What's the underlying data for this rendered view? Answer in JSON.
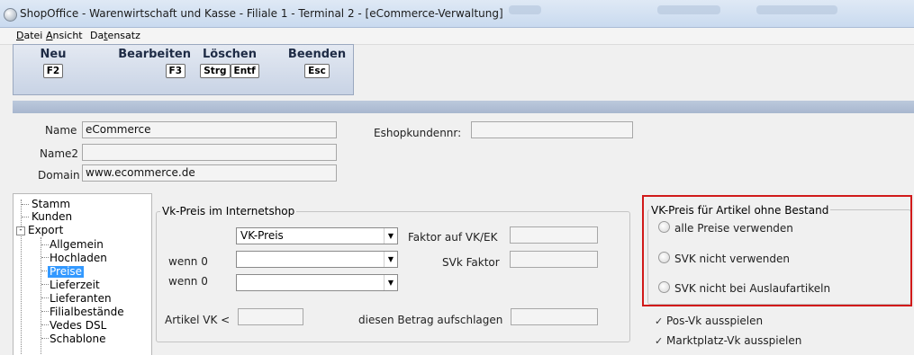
{
  "window": {
    "title": "ShopOffice - Warenwirtschaft und Kasse - Filiale 1 - Terminal 2 - [eCommerce-Verwaltung]"
  },
  "menu": {
    "datei": {
      "underline": "D",
      "rest": "atei"
    },
    "ansicht": {
      "underline": "A",
      "rest": "nsicht"
    },
    "datensatz": {
      "prefix": "Da",
      "underline": "t",
      "rest": "ensatz"
    }
  },
  "toolbar": {
    "neu": {
      "label": "Neu",
      "keys": [
        "F2"
      ]
    },
    "bearbeiten": {
      "label": "Bearbeiten",
      "keys": [
        "F3"
      ]
    },
    "loeschen": {
      "label": "Löschen",
      "keys": [
        "Strg",
        "Entf"
      ]
    },
    "beenden": {
      "label": "Beenden",
      "keys": [
        "Esc"
      ]
    }
  },
  "header": {
    "name_label": "Name",
    "name_value": "eCommerce",
    "name2_label": "Name2",
    "name2_value": "",
    "domain_label": "Domain",
    "domain_value": "www.ecommerce.de",
    "eshop_label": "Eshopkundennr:",
    "eshop_value": ""
  },
  "tree": {
    "stamm": "Stamm",
    "kunden": "Kunden",
    "export": "Export",
    "allgemein": "Allgemein",
    "hochladen": "Hochladen",
    "preise": "Preise",
    "lieferzeit": "Lieferzeit",
    "lieferanten": "Lieferanten",
    "filialbestaende": "Filialbestände",
    "vedes": "Vedes DSL",
    "schablone": "Schablone",
    "expander_minus": "-"
  },
  "vk_group": {
    "title": "Vk-Preis im Internetshop",
    "select1_value": "VK-Preis",
    "faktor_label": "Faktor auf VK/EK",
    "faktor_value": "",
    "wenn0_label_1": "wenn 0",
    "select2_value": "",
    "svk_label": "SVk Faktor",
    "svk_value": "",
    "wenn0_label_2": "wenn 0",
    "select3_value": "",
    "artikel_label": "Artikel VK <",
    "artikel_value": "",
    "aufschlag_label": "diesen Betrag aufschlagen",
    "aufschlag_value": ""
  },
  "bestand_group": {
    "title": "VK-Preis für Artikel ohne Bestand",
    "options": [
      "alle Preise verwenden",
      "SVK nicht verwenden",
      "SVK nicht bei Auslaufartikeln"
    ]
  },
  "checks": {
    "pos": {
      "mark": "✓",
      "label": "Pos-Vk ausspielen"
    },
    "markt": {
      "mark": "✓",
      "label": "Marktplatz-Vk ausspielen"
    }
  },
  "icons": {
    "dropdown": "▼"
  },
  "colors": {
    "highlight": "#d11a1a",
    "selection": "#3399ff"
  }
}
